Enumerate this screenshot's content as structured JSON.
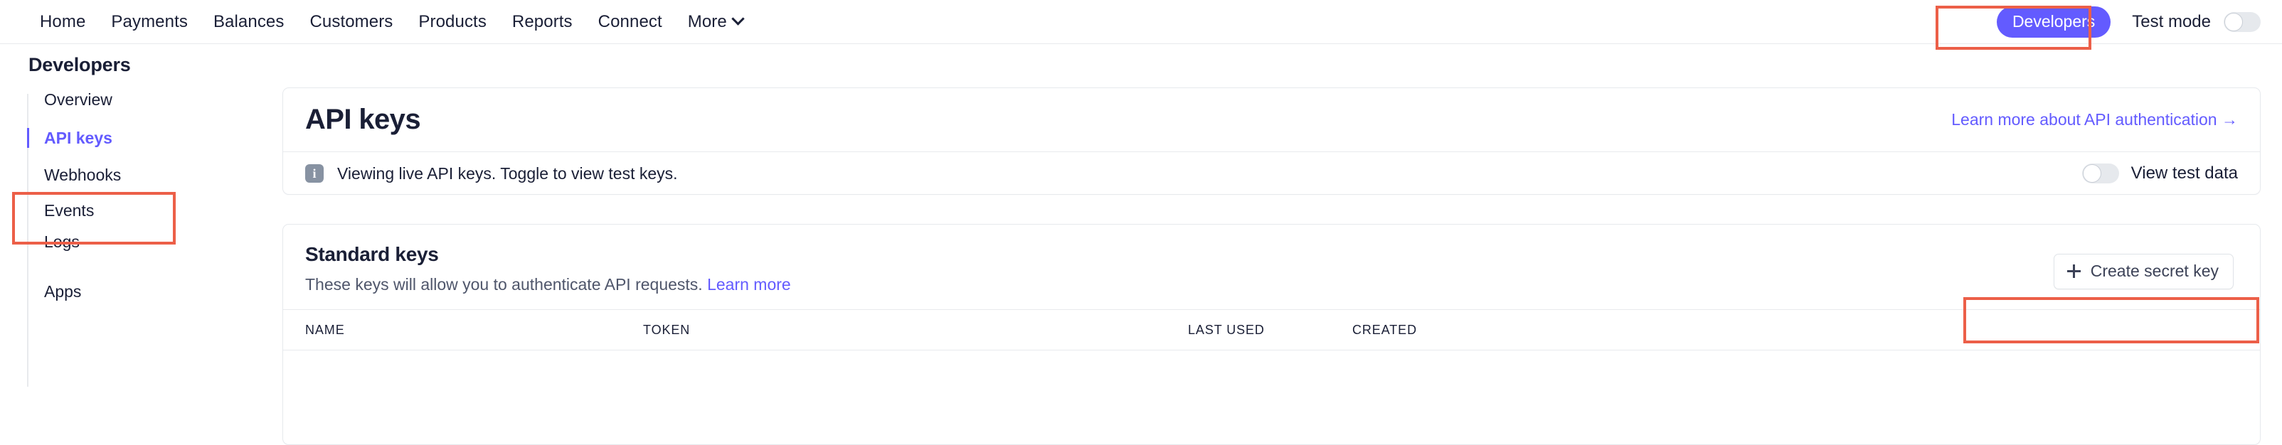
{
  "topnav": {
    "items": [
      {
        "label": "Home",
        "icon": null
      },
      {
        "label": "Payments",
        "icon": null
      },
      {
        "label": "Balances",
        "icon": null
      },
      {
        "label": "Customers",
        "icon": null
      },
      {
        "label": "Products",
        "icon": null
      },
      {
        "label": "Reports",
        "icon": null
      },
      {
        "label": "Connect",
        "icon": null
      },
      {
        "label": "More",
        "icon": "chevron-down-icon"
      }
    ],
    "developers_button": "Developers",
    "test_mode_label": "Test mode",
    "test_mode_on": false
  },
  "sidebar": {
    "title": "Developers",
    "items": [
      {
        "label": "Overview",
        "active": false
      },
      {
        "label": "API keys",
        "active": true
      },
      {
        "label": "Webhooks",
        "active": false
      },
      {
        "label": "Events",
        "active": false
      },
      {
        "label": "Logs",
        "active": false
      },
      {
        "label": "Apps",
        "active": false
      }
    ]
  },
  "main": {
    "page_title": "API keys",
    "learn_more_link": "Learn more about API authentication →",
    "banner": {
      "icon": "info-icon",
      "icon_glyph": "i",
      "text": "Viewing live API keys. Toggle to view test keys.",
      "toggle_label": "View test data",
      "toggle_on": false
    },
    "standard_keys": {
      "title": "Standard keys",
      "description": "These keys will allow you to authenticate API requests.",
      "description_link": "Learn more",
      "create_button": "Create secret key",
      "create_button_icon": "plus-icon",
      "table": {
        "columns": [
          "NAME",
          "TOKEN",
          "LAST USED",
          "CREATED"
        ],
        "rows": []
      }
    }
  },
  "annotations": [
    {
      "name": "developers-button-highlight",
      "color": "#ec5f48"
    },
    {
      "name": "api-keys-sidebar-highlight",
      "color": "#ec5f48"
    },
    {
      "name": "create-secret-key-highlight",
      "color": "#ec5f48"
    }
  ]
}
